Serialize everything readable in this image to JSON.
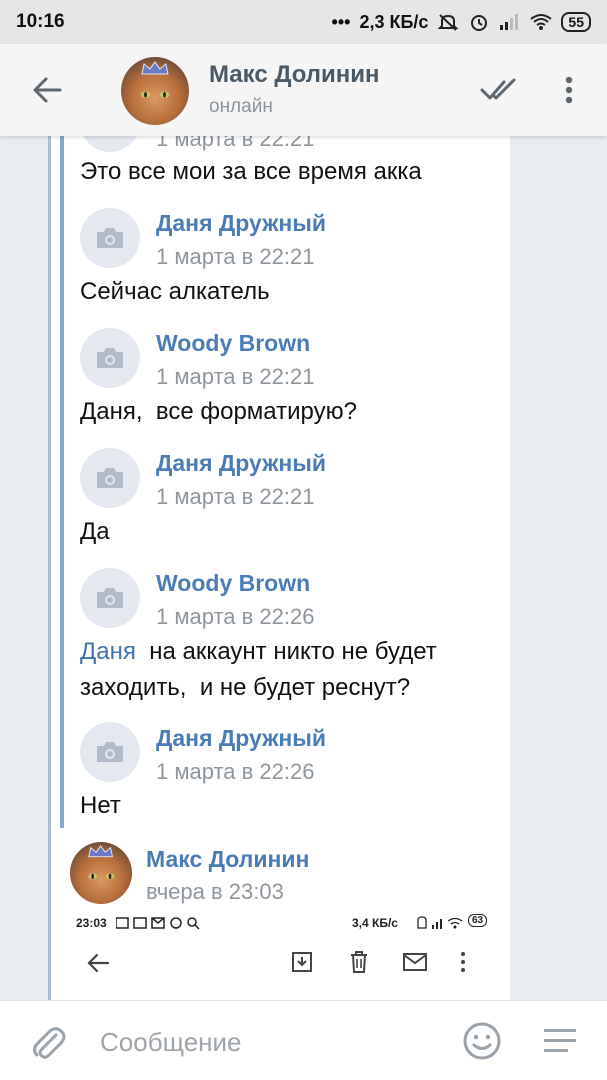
{
  "status_bar": {
    "time": "10:16",
    "dots": "•••",
    "speed": "2,3 КБ/с",
    "battery": "55"
  },
  "header": {
    "name": "Макс Долинин",
    "status": "онлайн"
  },
  "messages": [
    {
      "partial_date": "1 марта в 22:21",
      "text": "Это все мои за все время акка"
    },
    {
      "author": "Даня Дружный",
      "date": "1 марта в 22:21",
      "text": "Сейчас алкатель"
    },
    {
      "author": "Woody Brown",
      "date": "1 марта в 22:21",
      "text": "Даня,  все форматирую?"
    },
    {
      "author": "Даня Дружный",
      "date": "1 марта в 22:21",
      "text": "Да"
    },
    {
      "author": "Woody Brown",
      "date": "1 марта в 22:26",
      "mention": "Даня",
      "text_line1": "  на аккаунт никто не будет",
      "text_line2": "заходить,  и не будет реснут?"
    },
    {
      "author": "Даня Дружный",
      "date": "1 марта в 22:26",
      "text": "Нет"
    }
  ],
  "forward": {
    "author": "Макс Долинин",
    "date": "вчера в 23:03"
  },
  "inner_screenshot": {
    "time": "23:03",
    "speed": "3,4 КБ/с",
    "battery": "63"
  },
  "composer": {
    "placeholder": "Сообщение"
  },
  "colors": {
    "author": "#4a7cb5",
    "quote_bar": "#8aa7cc",
    "background": "#e9edf1"
  }
}
